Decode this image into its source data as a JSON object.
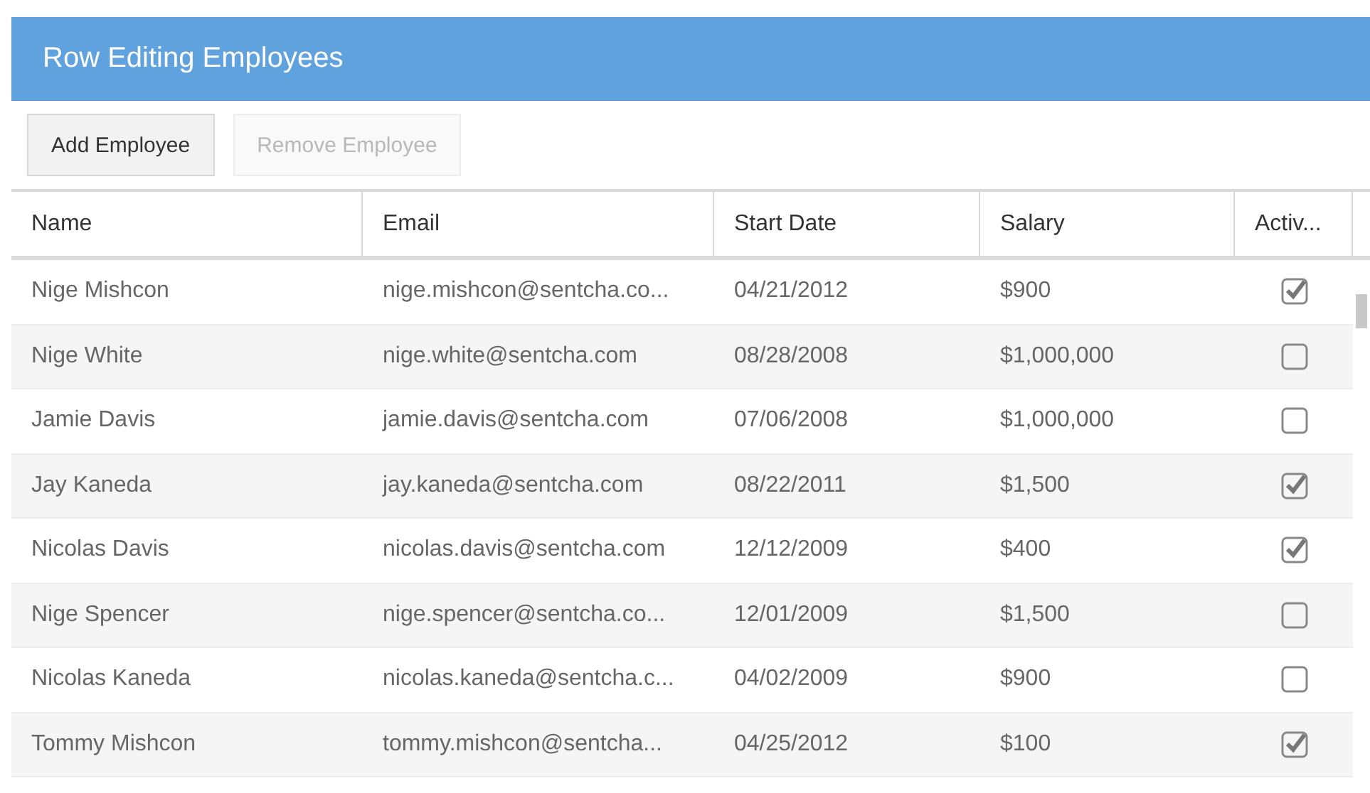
{
  "panel": {
    "title": "Row Editing Employees"
  },
  "toolbar": {
    "buttons": [
      {
        "label": "Add Employee",
        "disabled": false
      },
      {
        "label": "Remove Employee",
        "disabled": true
      }
    ]
  },
  "table": {
    "columns": [
      "Name",
      "Email",
      "Start Date",
      "Salary",
      "Activ..."
    ],
    "rows": [
      {
        "name": "Nige Mishcon",
        "email": "nige.mishcon@sentcha.co...",
        "start_date": "04/21/2012",
        "salary": "$900",
        "active": true
      },
      {
        "name": "Nige White",
        "email": "nige.white@sentcha.com",
        "start_date": "08/28/2008",
        "salary": "$1,000,000",
        "active": false
      },
      {
        "name": "Jamie Davis",
        "email": "jamie.davis@sentcha.com",
        "start_date": "07/06/2008",
        "salary": "$1,000,000",
        "active": false
      },
      {
        "name": "Jay Kaneda",
        "email": "jay.kaneda@sentcha.com",
        "start_date": "08/22/2011",
        "salary": "$1,500",
        "active": true
      },
      {
        "name": "Nicolas Davis",
        "email": "nicolas.davis@sentcha.com",
        "start_date": "12/12/2009",
        "salary": "$400",
        "active": true
      },
      {
        "name": "Nige Spencer",
        "email": "nige.spencer@sentcha.co...",
        "start_date": "12/01/2009",
        "salary": "$1,500",
        "active": false
      },
      {
        "name": "Nicolas Kaneda",
        "email": "nicolas.kaneda@sentcha.c...",
        "start_date": "04/02/2009",
        "salary": "$900",
        "active": false
      },
      {
        "name": "Tommy Mishcon",
        "email": "tommy.mishcon@sentcha...",
        "start_date": "04/25/2012",
        "salary": "$100",
        "active": true
      }
    ]
  }
}
